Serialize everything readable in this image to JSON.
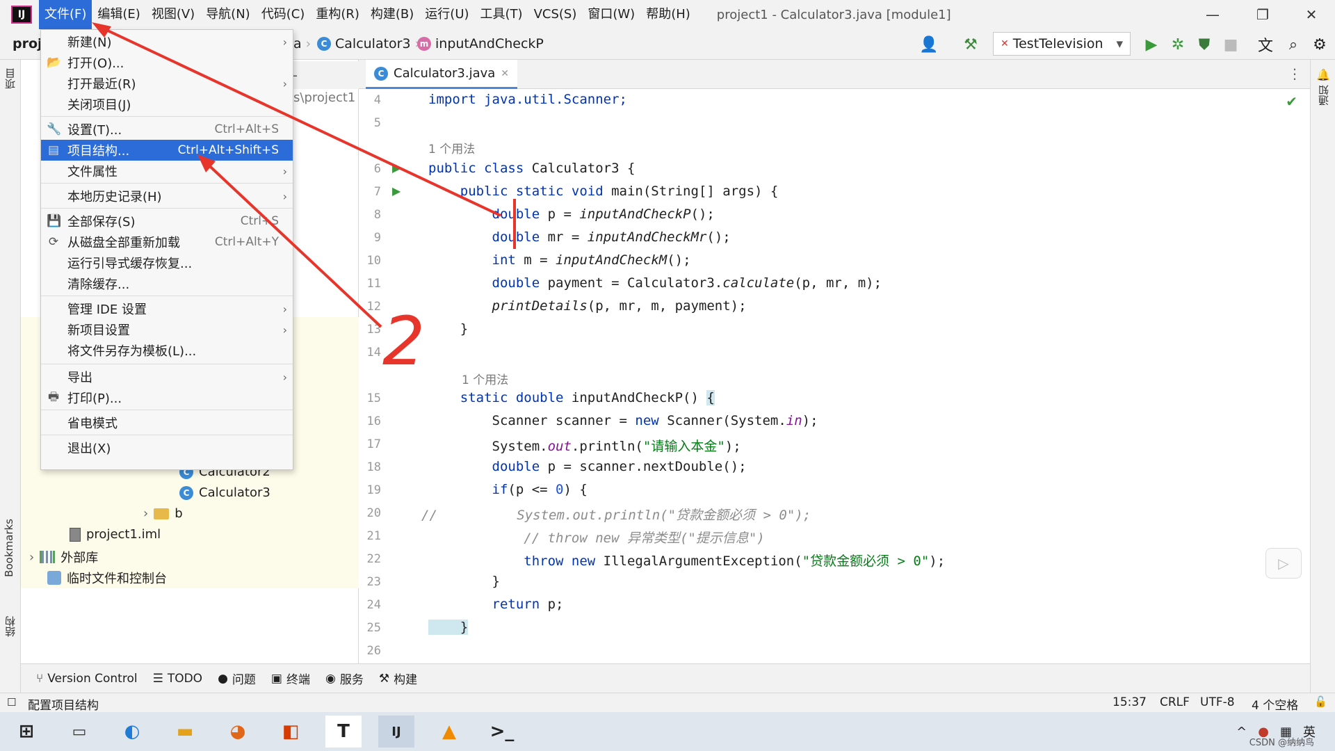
{
  "menubar": {
    "items": [
      "文件(F)",
      "编辑(E)",
      "视图(V)",
      "导航(N)",
      "代码(C)",
      "重构(R)",
      "构建(B)",
      "运行(U)",
      "工具(T)",
      "VCS(S)",
      "窗口(W)",
      "帮助(H)"
    ],
    "window_title": "project1 - Calculator3.java [module1]"
  },
  "toolbar": {
    "project_short": "proj",
    "crumb_prefix": "a",
    "crumb_class": "Calculator3",
    "crumb_method": "inputAndCheckP",
    "run_config": "TestTelevision"
  },
  "file_menu": {
    "items": [
      {
        "label": "新建(N)",
        "shortcut": "",
        "submenu": true,
        "icon": ""
      },
      {
        "label": "打开(O)...",
        "shortcut": "",
        "submenu": false,
        "icon": "folder-icon"
      },
      {
        "label": "打开最近(R)",
        "shortcut": "",
        "submenu": true,
        "icon": ""
      },
      {
        "label": "关闭项目(J)",
        "shortcut": "",
        "submenu": false,
        "icon": ""
      },
      {
        "label": "设置(T)...",
        "shortcut": "Ctrl+Alt+S",
        "submenu": false,
        "icon": "wrench-icon"
      },
      {
        "label": "项目结构...",
        "shortcut": "Ctrl+Alt+Shift+S",
        "submenu": false,
        "icon": "project-structure-icon",
        "selected": true
      },
      {
        "label": "文件属性",
        "shortcut": "",
        "submenu": true,
        "icon": ""
      },
      {
        "label": "本地历史记录(H)",
        "shortcut": "",
        "submenu": true,
        "icon": ""
      },
      {
        "label": "全部保存(S)",
        "shortcut": "Ctrl+S",
        "submenu": false,
        "icon": "save-icon"
      },
      {
        "label": "从磁盘全部重新加载",
        "shortcut": "Ctrl+Alt+Y",
        "submenu": false,
        "icon": "reload-icon"
      },
      {
        "label": "运行引导式缓存恢复...",
        "shortcut": "",
        "submenu": false,
        "icon": ""
      },
      {
        "label": "清除缓存...",
        "shortcut": "",
        "submenu": false,
        "icon": ""
      },
      {
        "label": "管理 IDE 设置",
        "shortcut": "",
        "submenu": true,
        "icon": ""
      },
      {
        "label": "新项目设置",
        "shortcut": "",
        "submenu": true,
        "icon": ""
      },
      {
        "label": "将文件另存为模板(L)...",
        "shortcut": "",
        "submenu": false,
        "icon": ""
      },
      {
        "label": "导出",
        "shortcut": "",
        "submenu": true,
        "icon": ""
      },
      {
        "label": "打印(P)...",
        "shortcut": "",
        "submenu": false,
        "icon": "print-icon"
      },
      {
        "label": "省电模式",
        "shortcut": "",
        "submenu": false,
        "icon": ""
      },
      {
        "label": "退出(X)",
        "shortcut": "",
        "submenu": false,
        "icon": ""
      }
    ]
  },
  "project_panel": {
    "path_fragment": "s\\project1",
    "tree": [
      {
        "label": "Calculator2",
        "kind": "class"
      },
      {
        "label": "Calculator3",
        "kind": "class"
      },
      {
        "label": "b",
        "kind": "folder"
      },
      {
        "label": "project1.iml",
        "kind": "iml"
      },
      {
        "label": "外部库",
        "kind": "library"
      },
      {
        "label": "临时文件和控制台",
        "kind": "scratch"
      }
    ]
  },
  "editor": {
    "tab": "Calculator3.java",
    "usage_hint": "1 个用法",
    "line_numbers": [
      "4",
      "5",
      "6",
      "7",
      "8",
      "9",
      "10",
      "11",
      "12",
      "13",
      "14",
      "15",
      "16",
      "17",
      "18",
      "19",
      "20",
      "21",
      "22",
      "23",
      "24",
      "25",
      "26"
    ],
    "code": {
      "l4": "import java.util.Scanner;",
      "l6a": "public class ",
      "l6b": "Calculator3 {",
      "l7a": "    public static void ",
      "l7b": "main(String[] args) {",
      "l8a": "        double ",
      "l8b": "p = ",
      "l8c": "inputAndCheckP",
      "l8d": "();",
      "l9a": "        double ",
      "l9b": "mr = ",
      "l9c": "inputAndCheckMr",
      "l9d": "();",
      "l10a": "        int ",
      "l10b": "m = ",
      "l10c": "inputAndCheckM",
      "l10d": "();",
      "l11a": "        double ",
      "l11b": "payment = Calculator3.",
      "l11c": "calculate",
      "l11d": "(p, mr, m);",
      "l12a": "        printDetails",
      "l12b": "(p, mr, m, payment);",
      "l13": "    }",
      "l15a": "    static double ",
      "l15b": "inputAndCheckP() ",
      "l15c": "{",
      "l16a": "        Scanner scanner = ",
      "l16b": "new ",
      "l16c": "Scanner(System.",
      "l16d": "in",
      "l16e": ");",
      "l17a": "        System.",
      "l17b": "out",
      "l17c": ".println(",
      "l17d": "\"请输入本金\"",
      "l17e": ");",
      "l18a": "        double ",
      "l18b": "p = scanner.nextDouble();",
      "l19a": "        if",
      "l19b": "(p <= ",
      "l19c": "0",
      "l19d": ") {",
      "l20a": "//",
      "l20b": "          System.out.println(\"贷款金额必须 > 0\");",
      "l21": "            // throw new 异常类型(\"提示信息\")",
      "l22a": "            throw new ",
      "l22b": "IllegalArgumentException(",
      "l22c": "\"贷款金额必须 > 0\"",
      "l22d": ");",
      "l23": "        }",
      "l24a": "        return ",
      "l24b": "p;",
      "l25": "    }"
    }
  },
  "bottom_tools": [
    "Version Control",
    "TODO",
    "问题",
    "终端",
    "服务",
    "构建"
  ],
  "left_labels": [
    "项目",
    "Bookmarks",
    "结构"
  ],
  "right_labels": [
    "通知"
  ],
  "status": {
    "message": "配置项目结构",
    "position": "15:37",
    "line_sep": "CRLF",
    "encoding": "UTF-8",
    "indent": "4 个空格",
    "watermark": "CSDN @纳纳鸟",
    "input_method": "英"
  },
  "annotation": {
    "mark": "2",
    "color": "#e8352b"
  },
  "taskbar": {
    "apps": [
      "windows-start-icon",
      "task-view-icon",
      "edge-icon",
      "file-explorer-icon",
      "firefox-icon",
      "office-icon",
      "typora-icon",
      "intellij-icon",
      "vlc-icon",
      "terminal-icon"
    ]
  }
}
